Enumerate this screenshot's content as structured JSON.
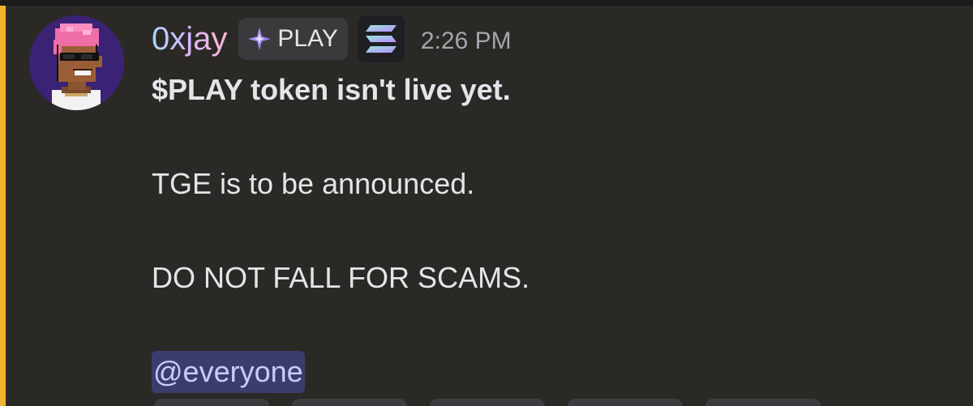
{
  "message": {
    "author": "0xjay",
    "tag": {
      "label": "PLAY",
      "icon": "sparkle-diamond-icon"
    },
    "app_badge_icon": "solana-logo-icon",
    "timestamp": "2:26 PM",
    "lines": {
      "headline": "$PLAY token isn't live yet.",
      "line2": "TGE is to be announced.",
      "line3": "DO NOT FALL FOR SCAMS."
    },
    "mention": "@everyone"
  },
  "colors": {
    "background": "#2b2926",
    "highlight_bar": "#f0b232",
    "mention_bg": "#4a4a8a",
    "timestamp": "#a4a6ab"
  }
}
